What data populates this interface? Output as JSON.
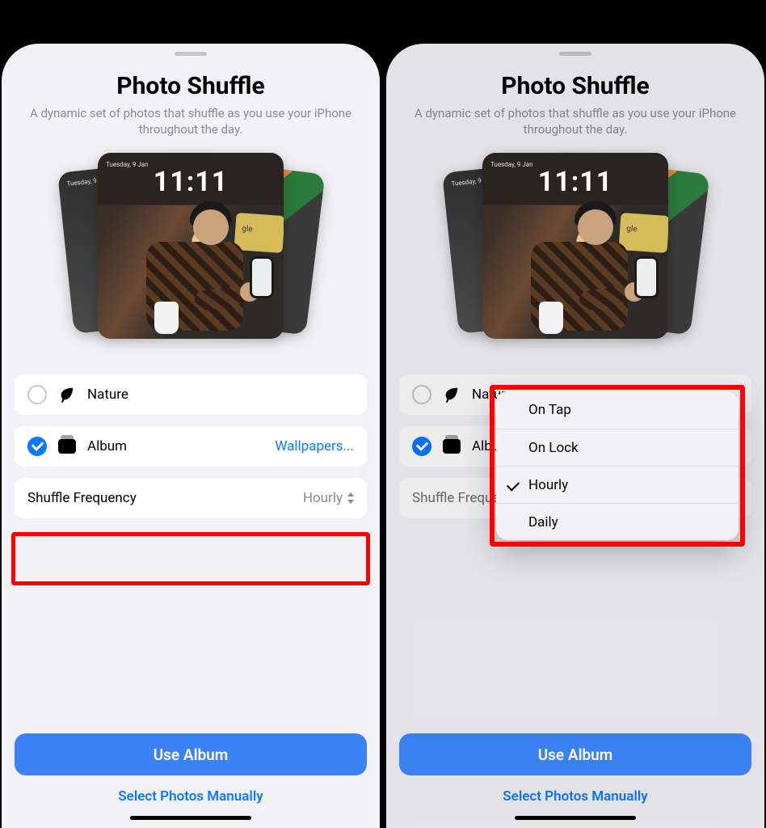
{
  "title": "Photo Shuffle",
  "subtitle": "A dynamic set of photos that shuffle as you use your iPhone throughout the day.",
  "preview_clock": "11:11",
  "preview_day": "Tuesday, 9 Jan",
  "options": {
    "nature": {
      "label": "Nature",
      "selected": false
    },
    "album": {
      "label": "Album",
      "selected": true,
      "value": "Wallpapers..."
    }
  },
  "shuffle": {
    "label": "Shuffle Frequency",
    "value": "Hourly"
  },
  "frequency_menu": {
    "items": [
      "On Tap",
      "On Lock",
      "Hourly",
      "Daily"
    ],
    "selected": "Hourly"
  },
  "footer": {
    "primary": "Use Album",
    "secondary": "Select Photos Manually"
  }
}
